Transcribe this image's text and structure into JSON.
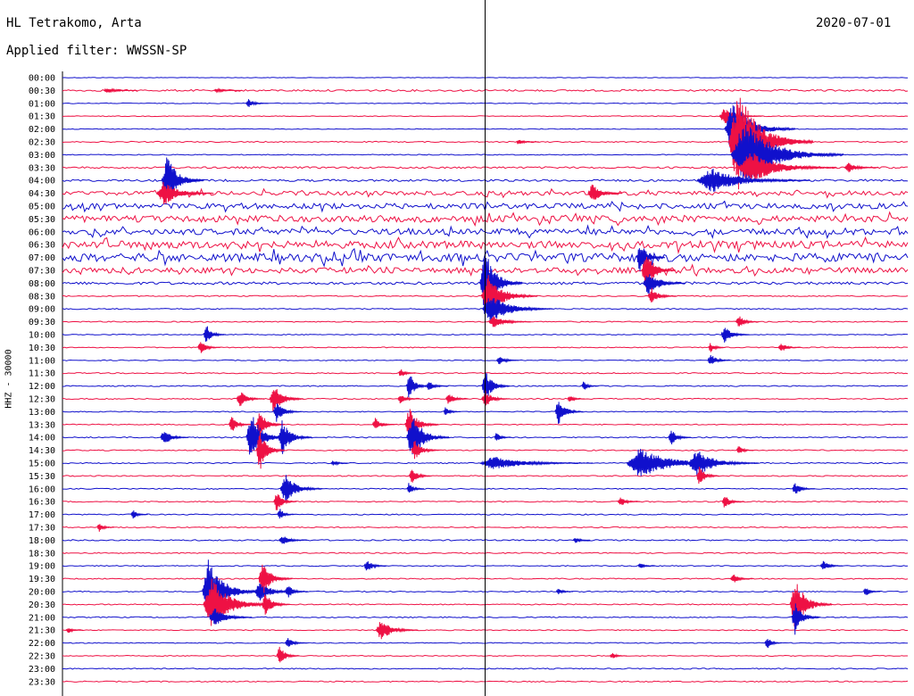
{
  "header": {
    "station": "HL Tetrakomo, Arta",
    "filter": "Applied filter: WWSSN-SP",
    "date": "2020-07-01"
  },
  "chart_data": {
    "type": "line",
    "title": "HL Tetrakomo, Arta",
    "subtitle": "Applied filter: WWSSN-SP",
    "ylabel": "HHZ - 30000",
    "xlabel": "",
    "trace_colors": [
      "#1010cc",
      "#ee1144"
    ],
    "rows": [
      "00:00",
      "00:30",
      "01:00",
      "01:30",
      "02:00",
      "02:30",
      "03:00",
      "03:30",
      "04:00",
      "04:30",
      "05:00",
      "05:30",
      "06:00",
      "06:30",
      "07:00",
      "07:30",
      "08:00",
      "08:30",
      "09:00",
      "09:30",
      "10:00",
      "10:30",
      "11:00",
      "11:30",
      "12:00",
      "12:30",
      "13:00",
      "13:30",
      "14:00",
      "14:30",
      "15:00",
      "15:30",
      "16:00",
      "16:30",
      "17:00",
      "17:30",
      "18:00",
      "18:30",
      "19:00",
      "19:30",
      "20:00",
      "20:30",
      "21:00",
      "21:30",
      "22:00",
      "22:30",
      "23:00",
      "23:30"
    ],
    "minute_marker": 15,
    "noise_levels": [
      0.3,
      1.0,
      0.4,
      0.4,
      0.4,
      0.6,
      0.5,
      1.0,
      1.2,
      2.2,
      3.0,
      3.5,
      3.2,
      4.0,
      4.5,
      3.0,
      1.5,
      0.6,
      0.6,
      0.6,
      0.5,
      0.5,
      0.5,
      0.6,
      0.6,
      0.6,
      0.5,
      0.5,
      0.6,
      0.6,
      0.6,
      0.6,
      0.5,
      0.6,
      0.6,
      0.6,
      0.7,
      0.6,
      0.5,
      0.6,
      0.6,
      0.6,
      0.6,
      0.5,
      0.5,
      0.5,
      0.6,
      0.6
    ],
    "events": [
      {
        "row": 1,
        "minute": 1.6,
        "amp": 3,
        "dur": 1.2
      },
      {
        "row": 1,
        "minute": 5.5,
        "amp": 2,
        "dur": 1.0
      },
      {
        "row": 2,
        "minute": 6.6,
        "amp": 5,
        "dur": 0.8
      },
      {
        "row": 5,
        "minute": 16.2,
        "amp": 3,
        "dur": 0.8
      },
      {
        "row": 3,
        "minute": 23.5,
        "amp": 10,
        "dur": 1.5
      },
      {
        "row": 4,
        "minute": 23.8,
        "amp": 35,
        "dur": 2.5
      },
      {
        "row": 5,
        "minute": 24.0,
        "amp": 60,
        "dur": 3.0
      },
      {
        "row": 6,
        "minute": 24.2,
        "amp": 40,
        "dur": 4.0
      },
      {
        "row": 7,
        "minute": 24.4,
        "amp": 20,
        "dur": 3.5
      },
      {
        "row": 8,
        "minute": 23.0,
        "amp": 15,
        "dur": 4.0
      },
      {
        "row": 7,
        "minute": 27.9,
        "amp": 6,
        "dur": 1.2
      },
      {
        "row": 8,
        "minute": 3.7,
        "amp": 30,
        "dur": 1.5
      },
      {
        "row": 9,
        "minute": 3.6,
        "amp": 14,
        "dur": 2.0
      },
      {
        "row": 9,
        "minute": 18.8,
        "amp": 12,
        "dur": 1.2
      },
      {
        "row": 14,
        "minute": 20.5,
        "amp": 20,
        "dur": 1.0
      },
      {
        "row": 15,
        "minute": 20.7,
        "amp": 25,
        "dur": 1.2
      },
      {
        "row": 16,
        "minute": 20.8,
        "amp": 15,
        "dur": 1.5
      },
      {
        "row": 17,
        "minute": 20.9,
        "amp": 10,
        "dur": 1.0
      },
      {
        "row": 16,
        "minute": 15.0,
        "amp": 40,
        "dur": 1.5
      },
      {
        "row": 17,
        "minute": 15.1,
        "amp": 25,
        "dur": 2.0
      },
      {
        "row": 18,
        "minute": 15.2,
        "amp": 18,
        "dur": 2.5
      },
      {
        "row": 19,
        "minute": 15.3,
        "amp": 8,
        "dur": 1.5
      },
      {
        "row": 24,
        "minute": 15.0,
        "amp": 20,
        "dur": 1.0
      },
      {
        "row": 25,
        "minute": 15.0,
        "amp": 10,
        "dur": 1.0
      },
      {
        "row": 20,
        "minute": 5.1,
        "amp": 12,
        "dur": 0.8
      },
      {
        "row": 20,
        "minute": 23.5,
        "amp": 10,
        "dur": 1.0
      },
      {
        "row": 19,
        "minute": 24.0,
        "amp": 8,
        "dur": 0.8
      },
      {
        "row": 21,
        "minute": 25.5,
        "amp": 6,
        "dur": 0.8
      },
      {
        "row": 21,
        "minute": 4.9,
        "amp": 8,
        "dur": 0.8
      },
      {
        "row": 25,
        "minute": 6.3,
        "amp": 10,
        "dur": 1.0
      },
      {
        "row": 25,
        "minute": 7.5,
        "amp": 18,
        "dur": 1.2
      },
      {
        "row": 26,
        "minute": 7.6,
        "amp": 12,
        "dur": 1.0
      },
      {
        "row": 27,
        "minute": 6.0,
        "amp": 10,
        "dur": 0.8
      },
      {
        "row": 27,
        "minute": 7.0,
        "amp": 16,
        "dur": 1.0
      },
      {
        "row": 28,
        "minute": 6.7,
        "amp": 30,
        "dur": 1.5
      },
      {
        "row": 28,
        "minute": 7.8,
        "amp": 20,
        "dur": 1.2
      },
      {
        "row": 29,
        "minute": 7.0,
        "amp": 25,
        "dur": 1.0
      },
      {
        "row": 32,
        "minute": 7.9,
        "amp": 18,
        "dur": 1.5
      },
      {
        "row": 33,
        "minute": 7.6,
        "amp": 12,
        "dur": 0.8
      },
      {
        "row": 34,
        "minute": 7.7,
        "amp": 8,
        "dur": 0.6
      },
      {
        "row": 28,
        "minute": 3.6,
        "amp": 10,
        "dur": 1.0
      },
      {
        "row": 25,
        "minute": 12.0,
        "amp": 6,
        "dur": 0.8
      },
      {
        "row": 27,
        "minute": 11.1,
        "amp": 8,
        "dur": 0.8
      },
      {
        "row": 24,
        "minute": 13.0,
        "amp": 6,
        "dur": 0.8
      },
      {
        "row": 25,
        "minute": 13.7,
        "amp": 8,
        "dur": 0.8
      },
      {
        "row": 26,
        "minute": 13.6,
        "amp": 6,
        "dur": 0.6
      },
      {
        "row": 23,
        "minute": 12.0,
        "amp": 6,
        "dur": 0.6
      },
      {
        "row": 24,
        "minute": 12.3,
        "amp": 18,
        "dur": 0.8
      },
      {
        "row": 27,
        "minute": 12.3,
        "amp": 20,
        "dur": 1.2
      },
      {
        "row": 28,
        "minute": 12.4,
        "amp": 30,
        "dur": 1.5
      },
      {
        "row": 29,
        "minute": 12.5,
        "amp": 12,
        "dur": 1.0
      },
      {
        "row": 31,
        "minute": 12.4,
        "amp": 10,
        "dur": 0.8
      },
      {
        "row": 32,
        "minute": 12.3,
        "amp": 8,
        "dur": 0.6
      },
      {
        "row": 30,
        "minute": 9.6,
        "amp": 4,
        "dur": 0.6
      },
      {
        "row": 30,
        "minute": 15.3,
        "amp": 8,
        "dur": 4.0
      },
      {
        "row": 30,
        "minute": 20.5,
        "amp": 18,
        "dur": 4.0
      },
      {
        "row": 30,
        "minute": 22.5,
        "amp": 16,
        "dur": 2.5
      },
      {
        "row": 31,
        "minute": 22.6,
        "amp": 12,
        "dur": 0.8
      },
      {
        "row": 28,
        "minute": 21.6,
        "amp": 10,
        "dur": 0.8
      },
      {
        "row": 29,
        "minute": 24.0,
        "amp": 6,
        "dur": 0.6
      },
      {
        "row": 28,
        "minute": 15.4,
        "amp": 6,
        "dur": 0.6
      },
      {
        "row": 26,
        "minute": 17.6,
        "amp": 16,
        "dur": 1.0
      },
      {
        "row": 25,
        "minute": 18.0,
        "amp": 6,
        "dur": 0.6
      },
      {
        "row": 24,
        "minute": 18.5,
        "amp": 6,
        "dur": 0.6
      },
      {
        "row": 22,
        "minute": 15.5,
        "amp": 6,
        "dur": 0.8
      },
      {
        "row": 22,
        "minute": 23.0,
        "amp": 8,
        "dur": 0.8
      },
      {
        "row": 21,
        "minute": 23.0,
        "amp": 6,
        "dur": 0.6
      },
      {
        "row": 32,
        "minute": 26.0,
        "amp": 8,
        "dur": 0.8
      },
      {
        "row": 33,
        "minute": 23.5,
        "amp": 8,
        "dur": 0.8
      },
      {
        "row": 33,
        "minute": 19.8,
        "amp": 6,
        "dur": 0.8
      },
      {
        "row": 34,
        "minute": 2.5,
        "amp": 6,
        "dur": 0.6
      },
      {
        "row": 35,
        "minute": 1.3,
        "amp": 6,
        "dur": 0.6
      },
      {
        "row": 36,
        "minute": 7.8,
        "amp": 6,
        "dur": 1.0
      },
      {
        "row": 36,
        "minute": 18.2,
        "amp": 4,
        "dur": 0.6
      },
      {
        "row": 38,
        "minute": 10.8,
        "amp": 8,
        "dur": 0.8
      },
      {
        "row": 38,
        "minute": 20.5,
        "amp": 4,
        "dur": 0.6
      },
      {
        "row": 38,
        "minute": 27.0,
        "amp": 6,
        "dur": 0.8
      },
      {
        "row": 39,
        "minute": 23.8,
        "amp": 6,
        "dur": 0.8
      },
      {
        "row": 40,
        "minute": 5.2,
        "amp": 40,
        "dur": 2.0
      },
      {
        "row": 41,
        "minute": 5.3,
        "amp": 30,
        "dur": 2.5
      },
      {
        "row": 42,
        "minute": 5.4,
        "amp": 12,
        "dur": 1.5
      },
      {
        "row": 40,
        "minute": 7.0,
        "amp": 12,
        "dur": 1.5
      },
      {
        "row": 39,
        "minute": 7.1,
        "amp": 20,
        "dur": 1.2
      },
      {
        "row": 41,
        "minute": 7.2,
        "amp": 14,
        "dur": 1.0
      },
      {
        "row": 40,
        "minute": 8.0,
        "amp": 8,
        "dur": 0.8
      },
      {
        "row": 40,
        "minute": 17.6,
        "amp": 4,
        "dur": 0.6
      },
      {
        "row": 40,
        "minute": 28.5,
        "amp": 6,
        "dur": 0.6
      },
      {
        "row": 41,
        "minute": 26.0,
        "amp": 30,
        "dur": 1.5
      },
      {
        "row": 42,
        "minute": 26.0,
        "amp": 20,
        "dur": 1.0
      },
      {
        "row": 43,
        "minute": 11.3,
        "amp": 12,
        "dur": 1.5
      },
      {
        "row": 43,
        "minute": 0.2,
        "amp": 4,
        "dur": 0.6
      },
      {
        "row": 44,
        "minute": 8.0,
        "amp": 6,
        "dur": 0.8
      },
      {
        "row": 44,
        "minute": 25.0,
        "amp": 8,
        "dur": 0.6
      },
      {
        "row": 45,
        "minute": 7.7,
        "amp": 12,
        "dur": 0.8
      },
      {
        "row": 45,
        "minute": 19.5,
        "amp": 4,
        "dur": 0.6
      }
    ]
  }
}
